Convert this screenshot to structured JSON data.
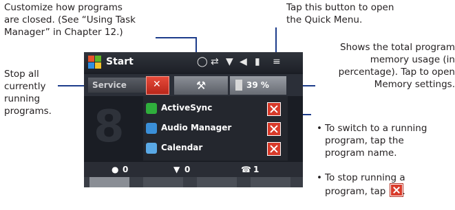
{
  "callouts": {
    "customize": "Customize how programs\nare closed. (See “Using Task\nManager” in Chapter 12.)",
    "quick_menu": "Tap this button to open\nthe Quick Menu.",
    "stop_all": "Stop all\ncurrently\nrunning\nprograms.",
    "memory": "Shows the total program\nmemory usage (in\npercentage). Tap to open\nMemory settings.",
    "switch_bullet": "To switch to a running\nprogram, tap the\nprogram name.",
    "stop_bullet": "To stop running a\nprogram, tap"
  },
  "device": {
    "title": "Start",
    "service_tab": "Service",
    "memory_usage": "39 %",
    "big_digit": "8",
    "processes": [
      {
        "name": "ActiveSync",
        "icon": "activesync-icon",
        "color": "#2fae3c"
      },
      {
        "name": "Audio Manager",
        "icon": "audio-manager-icon",
        "color": "#3a8fd8"
      },
      {
        "name": "Calendar",
        "icon": "calendar-icon",
        "color": "#5aa9e6"
      }
    ],
    "stats": [
      "0",
      "0",
      "1"
    ]
  },
  "colors": {
    "leader": "#1b3b8a",
    "close_red": "#d83a2a"
  }
}
